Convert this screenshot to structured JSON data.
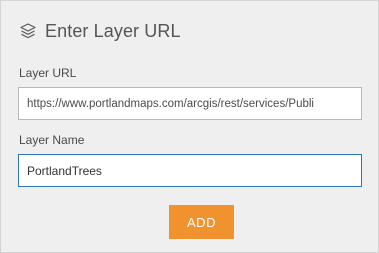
{
  "dialog": {
    "title": "Enter Layer URL",
    "icon": "layers-icon"
  },
  "form": {
    "url_label": "Layer URL",
    "url_value": "https://www.portlandmaps.com/arcgis/rest/services/Publi",
    "name_label": "Layer Name",
    "name_value": "PortlandTrees"
  },
  "actions": {
    "add_label": "ADD"
  },
  "colors": {
    "accent": "#f0932e",
    "focus_border": "#2f77b4",
    "panel_bg": "#efefef"
  }
}
